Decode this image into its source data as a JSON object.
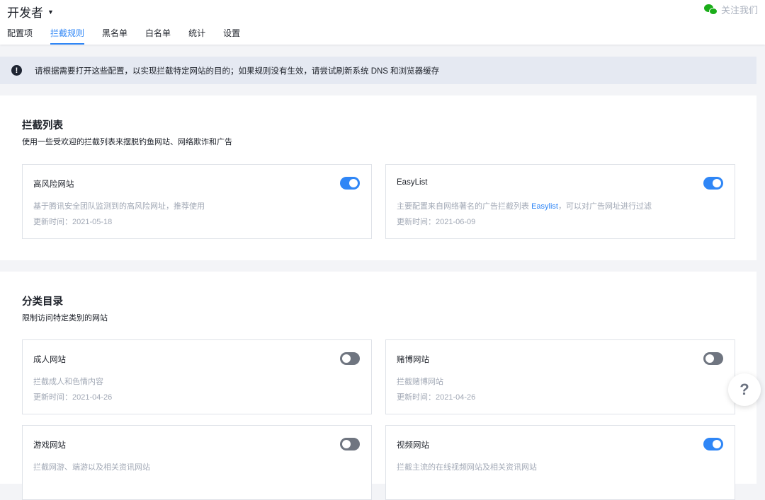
{
  "header": {
    "title": "开发者",
    "follow": "关注我们"
  },
  "tabs": [
    "配置项",
    "拦截规则",
    "黑名单",
    "白名单",
    "统计",
    "设置"
  ],
  "notice": "请根据需要打开这些配置，以实现拦截特定网站的目的；如果规则没有生效，请尝试刷新系统 DNS 和浏览器缓存",
  "blocklists": {
    "title": "拦截列表",
    "subtitle": "使用一些受欢迎的拦截列表来摆脱钓鱼网站、网络欺诈和广告",
    "cards": [
      {
        "name": "高风险网站",
        "desc": "基于腾讯安全团队监测到的高风险网址，推荐使用",
        "updated": "更新时间：2021-05-18",
        "enabled": true
      },
      {
        "name": "EasyList",
        "desc_pre": "主要配置来自网络著名的广告拦截列表 ",
        "desc_link": "Easylist",
        "desc_post": "，可以对广告网址进行过滤",
        "updated": "更新时间：2021-06-09",
        "enabled": true
      }
    ]
  },
  "categories": {
    "title": "分类目录",
    "subtitle": "限制访问特定类别的网站",
    "cards": [
      {
        "name": "成人网站",
        "desc": "拦截成人和色情内容",
        "updated": "更新时间：2021-04-26",
        "enabled": false
      },
      {
        "name": "赌博网站",
        "desc": "拦截赌博网站",
        "updated": "更新时间：2021-04-26",
        "enabled": false
      },
      {
        "name": "游戏网站",
        "desc": "拦截网游、端游以及相关资讯网站",
        "enabled": false
      },
      {
        "name": "视频网站",
        "desc": "拦截主流的在线视频网站及相关资讯网站",
        "enabled": true
      }
    ]
  },
  "help": "?",
  "colors": {
    "accent": "#2f86f6",
    "wechat": "#1aad19"
  }
}
